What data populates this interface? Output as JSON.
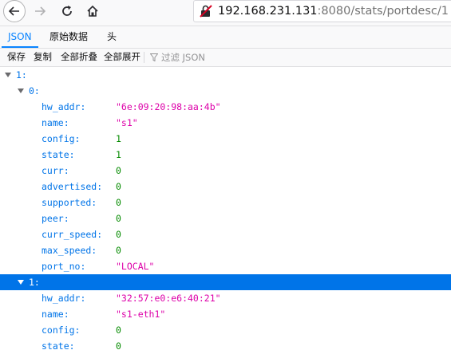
{
  "browser": {
    "url_host": "192.168.231.131",
    "url_rest": ":8080/stats/portdesc/1"
  },
  "tabs": [
    {
      "label": "JSON",
      "active": true
    },
    {
      "label": "原始数据",
      "active": false
    },
    {
      "label": "头",
      "active": false
    }
  ],
  "toolbar": {
    "save_label": "保存",
    "copy_label": "复制",
    "collapse_all_label": "全部折叠",
    "expand_all_label": "全部展开",
    "filter_placeholder": "过滤 JSON"
  },
  "tree": {
    "root_key": "1:",
    "items": [
      {
        "key": "0:",
        "fields": [
          {
            "key": "hw_addr:",
            "value": "\"6e:09:20:98:aa:4b\"",
            "type": "str"
          },
          {
            "key": "name:",
            "value": "\"s1\"",
            "type": "str"
          },
          {
            "key": "config:",
            "value": "1",
            "type": "num"
          },
          {
            "key": "state:",
            "value": "1",
            "type": "num"
          },
          {
            "key": "curr:",
            "value": "0",
            "type": "num"
          },
          {
            "key": "advertised:",
            "value": "0",
            "type": "num"
          },
          {
            "key": "supported:",
            "value": "0",
            "type": "num"
          },
          {
            "key": "peer:",
            "value": "0",
            "type": "num"
          },
          {
            "key": "curr_speed:",
            "value": "0",
            "type": "num"
          },
          {
            "key": "max_speed:",
            "value": "0",
            "type": "num"
          },
          {
            "key": "port_no:",
            "value": "\"LOCAL\"",
            "type": "str"
          }
        ]
      },
      {
        "key": "1:",
        "selected": true,
        "fields": [
          {
            "key": "hw_addr:",
            "value": "\"32:57:e0:e6:40:21\"",
            "type": "str"
          },
          {
            "key": "name:",
            "value": "\"s1-eth1\"",
            "type": "str"
          },
          {
            "key": "config:",
            "value": "0",
            "type": "num"
          },
          {
            "key": "state:",
            "value": "0",
            "type": "num"
          }
        ]
      }
    ]
  }
}
